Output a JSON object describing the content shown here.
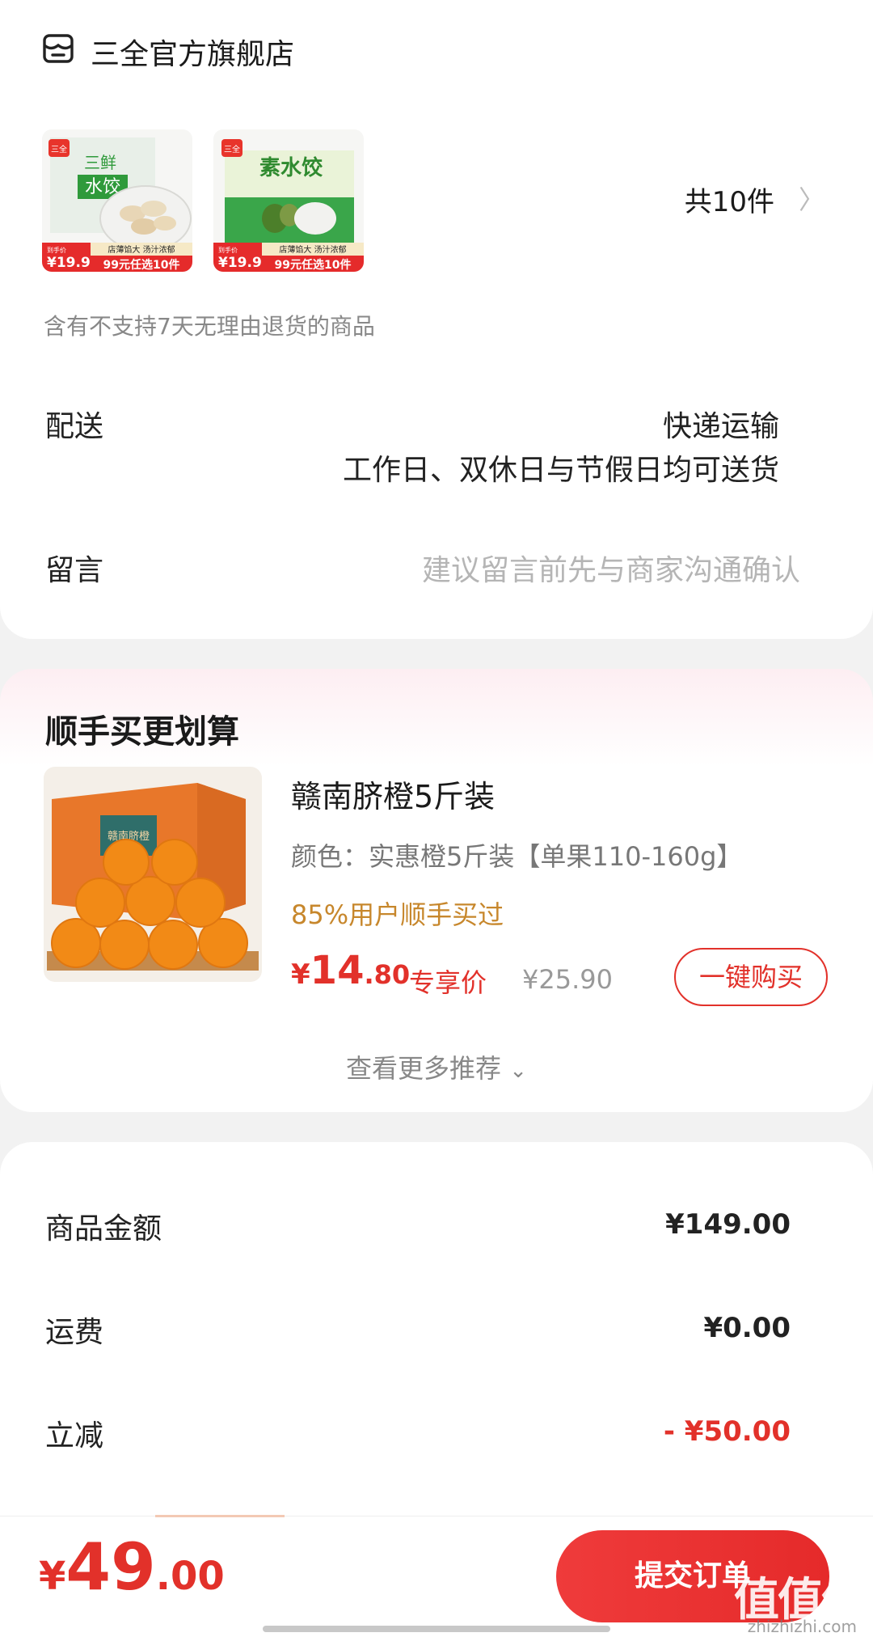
{
  "store": {
    "name": "三全官方旗舰店",
    "product_count": "共10件",
    "return_notice": "含有不支持7天无理由退货的商品",
    "thumbnails": [
      {
        "brand": "三全",
        "title_line1": "三鲜",
        "title_line2": "水饺",
        "promo_price": "¥19.9",
        "promo_desc": "店薄馅大 汤汁浓郁",
        "promo_deal": "99元任选10件"
      },
      {
        "brand": "三全",
        "title_line1": "素水饺",
        "title_line2": "",
        "promo_price": "¥19.9",
        "promo_desc": "店薄馅大 汤汁浓郁",
        "promo_deal": "99元任选10件"
      }
    ]
  },
  "delivery": {
    "label": "配送",
    "method": "快递运输",
    "schedule": "工作日、双休日与节假日均可送货"
  },
  "message": {
    "label": "留言",
    "placeholder": "建议留言前先与商家沟通确认"
  },
  "recommend": {
    "title": "顺手买更划算",
    "item": {
      "name": "赣南脐橙5斤装",
      "spec": "颜色：实惠橙5斤装【单果110-160g】",
      "stat": "85%用户顺手买过",
      "price_currency": "¥",
      "price_int": "14",
      "price_dec": ".80",
      "price_tag": "专享价",
      "original_price": "¥25.90",
      "box_text": "赣南脐橙"
    },
    "buy_label": "一键购买",
    "more_label": "查看更多推荐"
  },
  "summary": {
    "rows": [
      {
        "label": "商品金额",
        "value": "¥149.00"
      },
      {
        "label": "运费",
        "value": "¥0.00"
      },
      {
        "label": "立减",
        "value": "- ¥50.00"
      }
    ]
  },
  "bottom": {
    "total_currency": "¥",
    "total_int": "49",
    "total_dec": ".00",
    "submit_label": "提交订单",
    "watermark": "值值值",
    "watermark_site": "zhizhizhi.com"
  },
  "colors": {
    "accent": "#e2312a",
    "stat": "#c7872c"
  }
}
